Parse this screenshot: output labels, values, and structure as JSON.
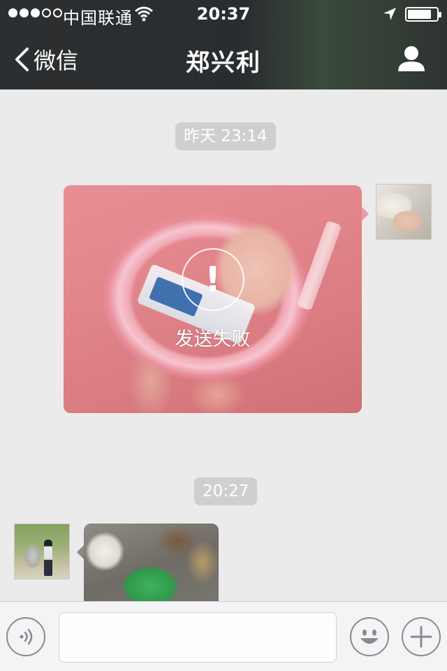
{
  "status_bar": {
    "signal_dots_filled": 3,
    "signal_dots_total": 5,
    "carrier": "中国联通",
    "time": "20:37",
    "battery_level": 0.85
  },
  "nav": {
    "back_label": "微信",
    "title": "郑兴利"
  },
  "messages": [
    {
      "type": "timestamp",
      "text": "昨天 23:14"
    },
    {
      "type": "image",
      "side": "right",
      "status_text": "发送失败",
      "status_icon": "!"
    },
    {
      "type": "timestamp",
      "text": "20:27"
    },
    {
      "type": "image",
      "side": "left"
    }
  ],
  "input_bar": {
    "text_value": "",
    "voice_icon": "voice-icon",
    "emoji_icon": "emoji-icon",
    "more_icon": "plus-icon"
  },
  "colors": {
    "nav_background": "#2c2f31",
    "chat_background": "#ebebeb",
    "timestamp_pill": "#cfcfcf"
  }
}
